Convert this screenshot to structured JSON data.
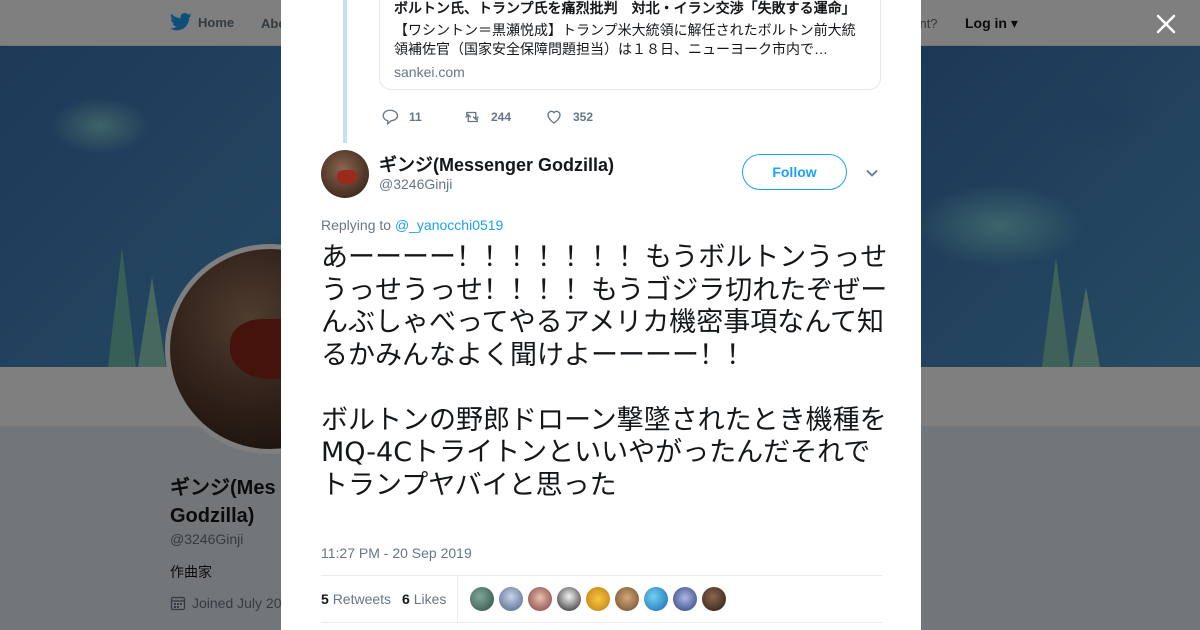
{
  "nav": {
    "home_label": "Home",
    "about_label": "Abo",
    "account_text": "ccount?",
    "login_label": "Log in"
  },
  "profile": {
    "name": "ギンジ(Messenger Godzilla)",
    "name_visible": "ギンジ(Mes\nGodzilla)",
    "handle": "@3246Ginji",
    "bio": "作曲家",
    "joined": "Joined July 20"
  },
  "card": {
    "title": "ボルトン氏、トランプ氏を痛烈批判　対北・イラン交渉「失敗する運命」",
    "description": "【ワシントン＝黒瀬悦成】トランプ米大統領に解任されたボルトン前大統領補佐官（国家安全保障問題担当）は１８日、ニューヨーク市内で…",
    "domain": "sankei.com"
  },
  "parent_actions": {
    "replies": "11",
    "retweets": "244",
    "likes": "352"
  },
  "tweet": {
    "author_name": "ギンジ(Messenger Godzilla)",
    "author_handle": "@3246Ginji",
    "follow_label": "Follow",
    "replying_prefix": "Replying to ",
    "replying_to": "@_yanocchi0519",
    "text": "あーーーー！！！！！！！もうボルトンうっせうっせうっせ！！！！もうゴジラ切れたぞぜーんぶしゃべってやるアメリカ機密事項なんて知るかみんなよく聞けよーーーー！！\n\nボルトンの野郎ドローン撃墜されたとき機種をMQ-4Cトライトンといいやがったんだそれでトランプヤバイと思った",
    "timestamp": "11:27 PM - 20 Sep 2019",
    "retweets_count": "5",
    "retweets_label": "Retweets",
    "likes_count": "6",
    "likes_label": "Likes"
  },
  "colors": {
    "accent": "#1da1f2",
    "secondary_text": "#657786",
    "thread_line": "#c4e0f5"
  },
  "likers": [
    "liker-1",
    "liker-2",
    "liker-3",
    "liker-4",
    "liker-5",
    "liker-6",
    "liker-7",
    "liker-8",
    "liker-9"
  ]
}
